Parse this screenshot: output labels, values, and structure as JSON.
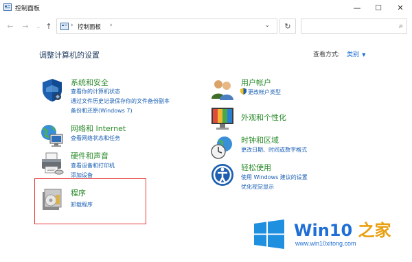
{
  "window": {
    "title": "控制面板",
    "minimize": "—",
    "maximize": "☐",
    "close": "✕"
  },
  "nav": {
    "back": "←",
    "forward": "→",
    "recent": "⌄",
    "up": "↑",
    "breadcrumb": "控制面板",
    "sep": "›",
    "dropdown": "⌄",
    "refresh": "↻",
    "search_icon": "⌕"
  },
  "main": {
    "heading": "调整计算机的设置",
    "view_by_label": "查看方式:",
    "view_by_value": "类别",
    "view_by_arrow": "▼"
  },
  "categories_left": [
    {
      "title": "系统和安全",
      "icon": "shield-icon",
      "links": [
        "查看你的计算机状态",
        "通过文件历史记录保存你的文件备份副本",
        "备份和还原(Windows 7)"
      ]
    },
    {
      "title": "网络和 Internet",
      "icon": "globe-network-icon",
      "links": [
        "查看网络状态和任务"
      ]
    },
    {
      "title": "硬件和声音",
      "icon": "printer-icon",
      "links": [
        "查看设备和打印机",
        "添加设备"
      ]
    },
    {
      "title": "程序",
      "icon": "program-disk-icon",
      "links": [
        "卸载程序"
      ]
    }
  ],
  "categories_right": [
    {
      "title": "用户帐户",
      "icon": "users-icon",
      "links": [
        "更改帐户类型"
      ]
    },
    {
      "title": "外观和个性化",
      "icon": "monitor-icon",
      "links": []
    },
    {
      "title": "时钟和区域",
      "icon": "clock-globe-icon",
      "links": [
        "更改日期、时间或数字格式"
      ]
    },
    {
      "title": "轻松使用",
      "icon": "ease-of-access-icon",
      "links": [
        "使用 Windows 建议的设置",
        "优化视觉显示"
      ]
    }
  ],
  "watermark": {
    "brand": "Win10",
    "suffix": "之家",
    "url": "www.win10xitong.com"
  },
  "colors": {
    "category_title": "#2a8a2a",
    "link": "#1a5fb4",
    "highlight": "#e53935",
    "watermark_blue": "#1f6fd6",
    "watermark_orange": "#e8a010"
  }
}
